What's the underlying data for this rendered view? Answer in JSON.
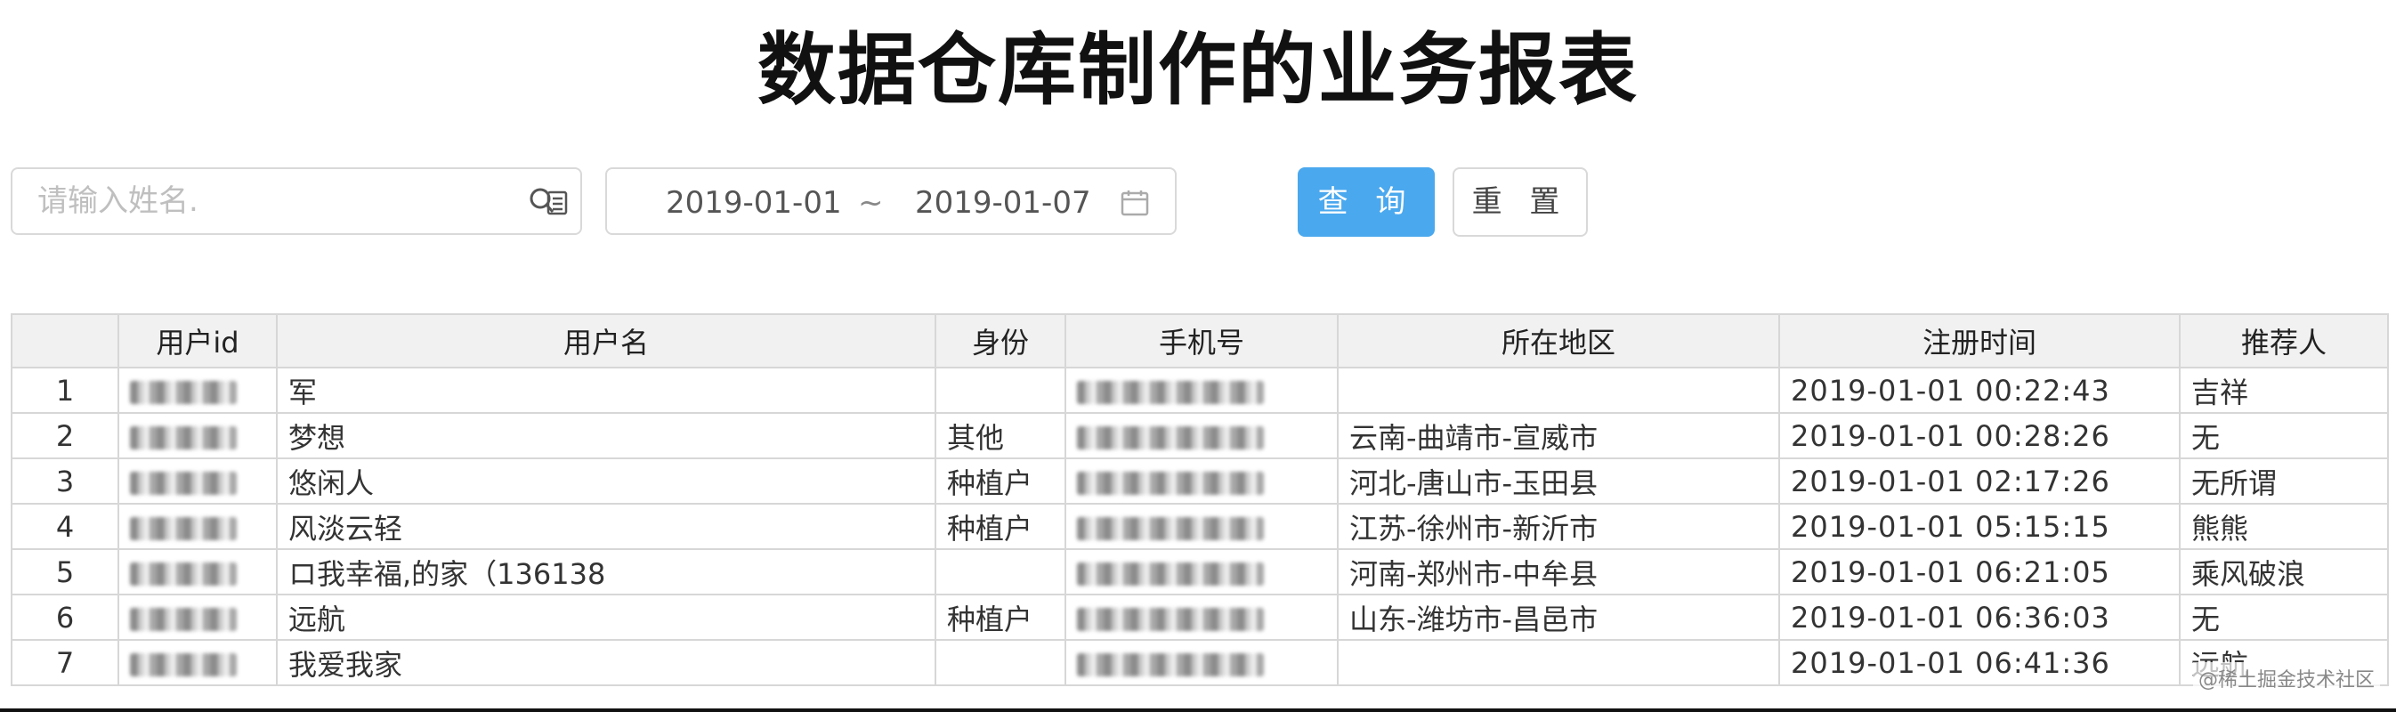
{
  "page": {
    "title": "数据仓库制作的业务报表"
  },
  "filters": {
    "name_placeholder": "请输入姓名.",
    "date_start": "2019-01-01",
    "date_separator": "~",
    "date_end": "2019-01-07",
    "query_label": "查 询",
    "reset_label": "重 置"
  },
  "table": {
    "headers": [
      "",
      "用户id",
      "用户名",
      "身份",
      "手机号",
      "所在地区",
      "注册时间",
      "推荐人"
    ],
    "rows": [
      {
        "index": "1",
        "name": "军",
        "identity": "",
        "region": "",
        "register_time": "2019-01-01 00:22:43",
        "referrer": "吉祥"
      },
      {
        "index": "2",
        "name": "梦想",
        "identity": "其他",
        "region": "云南-曲靖市-宣威市",
        "register_time": "2019-01-01 00:28:26",
        "referrer": "无"
      },
      {
        "index": "3",
        "name": "悠闲人",
        "identity": "种植户",
        "region": "河北-唐山市-玉田县",
        "register_time": "2019-01-01 02:17:26",
        "referrer": "无所谓"
      },
      {
        "index": "4",
        "name": "风淡云轻",
        "identity": "种植户",
        "region": "江苏-徐州市-新沂市",
        "register_time": "2019-01-01 05:15:15",
        "referrer": "熊熊"
      },
      {
        "index": "5",
        "name": "ロ我幸福,的家（136138",
        "identity": "",
        "region": "河南-郑州市-中牟县",
        "register_time": "2019-01-01 06:21:05",
        "referrer": "乘风破浪"
      },
      {
        "index": "6",
        "name": "远航",
        "identity": "种植户",
        "region": "山东-潍坊市-昌邑市",
        "register_time": "2019-01-01 06:36:03",
        "referrer": "无"
      },
      {
        "index": "7",
        "name": "我爱我家",
        "identity": "",
        "region": "",
        "register_time": "2019-01-01 06:41:36",
        "referrer": "远航"
      }
    ]
  },
  "watermark": "@稀土掘金技术社区",
  "icons": {
    "search": "search-icon",
    "calendar": "calendar-icon"
  },
  "colors": {
    "primary": "#4aa8ee",
    "border": "#d9d9d9",
    "header_bg": "#f1f1f1"
  }
}
